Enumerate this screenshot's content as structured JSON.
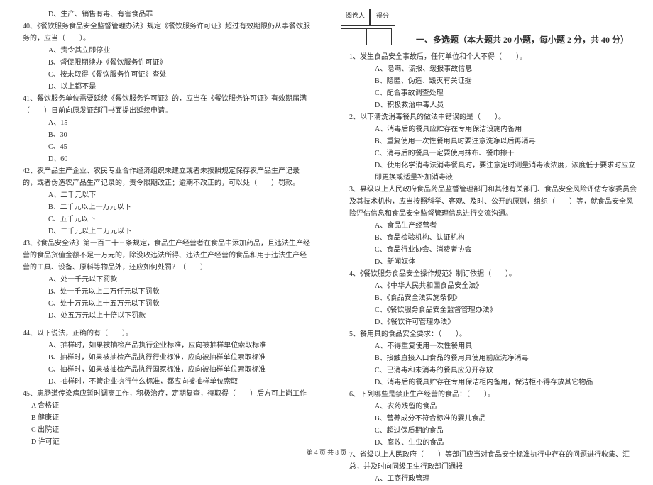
{
  "left": {
    "q39d": "D、生产、销售有毒、有害食品罪",
    "q40": "40、《餐饮服务食品安全监督管理办法》规定《餐饮服务许可证》超过有效期限仍从事餐饮服务的，应当（　　）。",
    "q40a": "A、责令其立即停业",
    "q40b": "B、督促限期续办《餐饮服务许可证》",
    "q40c": "C、按未取得《餐饮服务许可证》查处",
    "q40d": "D、以上都不是",
    "q41": "41、餐饮服务单位需要延续《餐饮服务许可证》的，应当在《餐饮服务许可证》有效期届满（　　）日前向原发证部门书面提出延续申请。",
    "q41a": "A、15",
    "q41b": "B、30",
    "q41c": "C、45",
    "q41d": "D、60",
    "q42": "42、农产品生产企业、农民专业合作经济组织未建立或者未按照规定保存农产品生产记录的，或者伪造农产品生产记录的，责令限期改正；逾期不改正的，可以处（　　）罚款。",
    "q42a": "A、二千元以下",
    "q42b": "B、二千元以上一万元以下",
    "q42c": "C、五千元以下",
    "q42d": "D、二千元以上二万元以下",
    "q43": "43、《食品安全法》第一百二十三条规定，食品生产经营者在食品中添加药品，且违法生产经营的食品货值金额不足一万元的，除没收违法所得、违法生产经营的食品和用于违法生产经营的工具、设备、原料等物品外，还应如何处罚？（　　）",
    "q43a": "A、处一千元以下罚款",
    "q43b": "B、处一千元以上二万仟元以下罚款",
    "q43c": "C、处十万元以上十五万元以下罚款",
    "q43d": "D、处五万元以上十倍以下罚款",
    "q44": "44、以下说法，正确的有（　　）。",
    "q44a": "A、抽样时，如果被抽检产品执行企业标准，应向被抽样单位索取标准",
    "q44b": "B、抽样时，如果被抽检产品执行行业标准，应向被抽样单位索取标准",
    "q44c": "C、抽样时，如果被抽检产品执行国家标准，应向被抽样单位索取标准",
    "q44d": "D、抽样时，不管企业执行什么标准，都应向被抽样单位索取",
    "q45": "45、患肠道传染病应暂时调离工作，积极治疗，定期复查，待取得（　　）后方可上岗工作",
    "q45a": "A 合格证",
    "q45b": "B 健康证",
    "q45c": "C 出院证",
    "q45d": "D 许可证"
  },
  "right": {
    "score_label1": "阅卷人",
    "score_label2": "得分",
    "section_title": "一、多选题（本大题共 20 小题，每小题 2 分，共 40 分）",
    "q1": "1、发生食品安全事故后，任何单位和个人不得（　　）。",
    "q1a": "A、隐瞒、谎报、缓报事故信息",
    "q1b": "B、隐匿、伪造、毁灭有关证据",
    "q1c": "C、配合事故调查处理",
    "q1d": "D、积极救治中毒人员",
    "q2": "2、以下清洗消毒餐具的做法中错误的是（　　）。",
    "q2a": "A、消毒后的餐具应贮存在专用保洁设施内备用",
    "q2b": "B、重复使用一次性餐用具时要注意洗净以后再消毒",
    "q2c": "C、消毒后的餐具一定要使用抹布、餐巾擦干",
    "q2d": "D、使用化学消毒法消毒餐具时，要注意定时测量消毒液浓度，浓度低于要求时应立即更换或适量补加消毒液",
    "q3": "3、县级以上人民政府食品药品监督管理部门和其他有关部门、食品安全风险评估专家委员会及其技术机构，应当按照科学、客观、及时、公开的原则，组织（　　）等，就食品安全风险评估信息和食品安全监督管理信息进行交流沟通。",
    "q3a": "A、食品生产经营者",
    "q3b": "B、食品检验机构、认证机构",
    "q3c": "C、食品行业协会、消费者协会",
    "q3d": "D、新闻媒体",
    "q4": "4、《餐饮服务食品安全操作规范》制订依据（　　）。",
    "q4a": "A、《中华人民共和国食品安全法》",
    "q4b": "B、《食品安全法实施条例》",
    "q4c": "C、《餐饮服务食品安全监督管理办法》",
    "q4d": "D、《餐饮许可管理办法》",
    "q5": "5、餐用具的食品安全要求：（　　）。",
    "q5a": "A、不得重复使用一次性餐用具",
    "q5b": "B、接触直接入口食品的餐用具使用前应洗净消毒",
    "q5c": "C、已消毒和未消毒的餐具应分开存放",
    "q5d": "D、消毒后的餐具贮存在专用保洁柜内备用，保洁柜不得存放其它物品",
    "q6": "6、下列哪些是禁止生产经营的食品：（　　）。",
    "q6a": "A、农药残留的食品",
    "q6b": "B、营养成分不符合标准的婴儿食品",
    "q6c": "C、超过保质期的食品",
    "q6d": "D、腐败、生虫的食品",
    "q7": "7、省级以上人民政府（　　）等部门应当对食品安全标准执行中存在的问题进行收集、汇总，并及时向同级卫生行政部门通报",
    "q7a": "A、工商行政管理"
  },
  "footer": "第 4 页 共 8 页"
}
